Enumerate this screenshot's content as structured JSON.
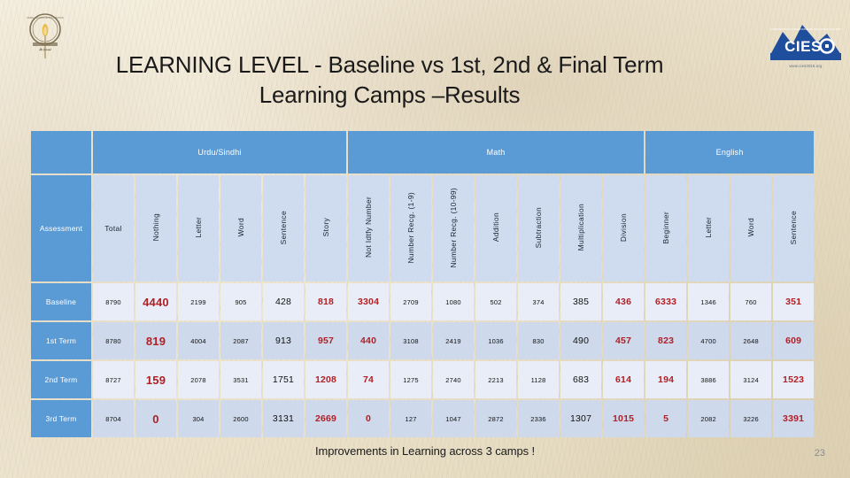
{
  "slide": {
    "title_line1": "LEARNING LEVEL  - Baseline vs 1st, 2nd & Final Term",
    "title_line2": "Learning Camps –Results",
    "footer_note": "Improvements in Learning across 3 camps !",
    "page_number": "23"
  },
  "logos": {
    "left": {
      "name": "institution-seal-logo"
    },
    "right": {
      "name": "cieso-logo",
      "text": "CIESO",
      "url": "www.cies2015.org"
    }
  },
  "colors": {
    "header_blue": "#5b9bd5",
    "subheader_blue": "#cfdcef",
    "row_light": "#e8edf7",
    "row_dark": "#ced9ec",
    "highlight_red": "#b02025",
    "text_dark": "#111111"
  },
  "table": {
    "row_label_header": "Assessment",
    "groups": [
      {
        "label": "",
        "span": 1
      },
      {
        "label": "Urdu/Sindhi",
        "span": 6
      },
      {
        "label": "Math",
        "span": 7
      },
      {
        "label": "English",
        "span": 4
      }
    ],
    "columns": [
      {
        "label": "Total",
        "orientation": "horizontal"
      },
      {
        "label": "Nothing",
        "orientation": "vertical"
      },
      {
        "label": "Letter",
        "orientation": "vertical"
      },
      {
        "label": "Word",
        "orientation": "vertical"
      },
      {
        "label": "Sentence",
        "orientation": "vertical"
      },
      {
        "label": "Story",
        "orientation": "vertical"
      },
      {
        "label": "Not Idtfy Number",
        "orientation": "vertical"
      },
      {
        "label": "Number Recg. (1-9)",
        "orientation": "vertical"
      },
      {
        "label": "Number Recg. (10-99)",
        "orientation": "vertical"
      },
      {
        "label": "Addition",
        "orientation": "vertical"
      },
      {
        "label": "Subtraction",
        "orientation": "vertical"
      },
      {
        "label": "Multiplication",
        "orientation": "vertical"
      },
      {
        "label": "Division",
        "orientation": "vertical"
      },
      {
        "label": "Beginner",
        "orientation": "vertical"
      },
      {
        "label": "Letter",
        "orientation": "vertical"
      },
      {
        "label": "Word",
        "orientation": "vertical"
      },
      {
        "label": "Sentence",
        "orientation": "vertical"
      }
    ],
    "rows": [
      {
        "label": "Baseline",
        "shade": "light",
        "cells": [
          {
            "value": "8790",
            "size": "sm",
            "color": "dark"
          },
          {
            "value": "4440",
            "size": "lg",
            "color": "red"
          },
          {
            "value": "2199",
            "size": "sm",
            "color": "dark"
          },
          {
            "value": "905",
            "size": "sm",
            "color": "dark"
          },
          {
            "value": "428",
            "size": "md",
            "color": "dark"
          },
          {
            "value": "818",
            "size": "md",
            "color": "red"
          },
          {
            "value": "3304",
            "size": "md",
            "color": "red"
          },
          {
            "value": "2709",
            "size": "sm",
            "color": "dark"
          },
          {
            "value": "1080",
            "size": "sm",
            "color": "dark"
          },
          {
            "value": "502",
            "size": "sm",
            "color": "dark"
          },
          {
            "value": "374",
            "size": "sm",
            "color": "dark"
          },
          {
            "value": "385",
            "size": "md",
            "color": "dark"
          },
          {
            "value": "436",
            "size": "md",
            "color": "red"
          },
          {
            "value": "6333",
            "size": "md",
            "color": "red"
          },
          {
            "value": "1346",
            "size": "sm",
            "color": "dark"
          },
          {
            "value": "760",
            "size": "sm",
            "color": "dark"
          },
          {
            "value": "351",
            "size": "md",
            "color": "red"
          }
        ]
      },
      {
        "label": "1st Term",
        "shade": "dark",
        "cells": [
          {
            "value": "8780",
            "size": "sm",
            "color": "dark"
          },
          {
            "value": "819",
            "size": "lg",
            "color": "red"
          },
          {
            "value": "4004",
            "size": "sm",
            "color": "dark"
          },
          {
            "value": "2087",
            "size": "sm",
            "color": "dark"
          },
          {
            "value": "913",
            "size": "md",
            "color": "dark"
          },
          {
            "value": "957",
            "size": "md",
            "color": "red"
          },
          {
            "value": "440",
            "size": "md",
            "color": "red"
          },
          {
            "value": "3108",
            "size": "sm",
            "color": "dark"
          },
          {
            "value": "2419",
            "size": "sm",
            "color": "dark"
          },
          {
            "value": "1036",
            "size": "sm",
            "color": "dark"
          },
          {
            "value": "830",
            "size": "sm",
            "color": "dark"
          },
          {
            "value": "490",
            "size": "md",
            "color": "dark"
          },
          {
            "value": "457",
            "size": "md",
            "color": "red"
          },
          {
            "value": "823",
            "size": "md",
            "color": "red"
          },
          {
            "value": "4700",
            "size": "sm",
            "color": "dark"
          },
          {
            "value": "2648",
            "size": "sm",
            "color": "dark"
          },
          {
            "value": "609",
            "size": "md",
            "color": "red"
          }
        ]
      },
      {
        "label": "2nd Term",
        "shade": "light",
        "cells": [
          {
            "value": "8727",
            "size": "sm",
            "color": "dark"
          },
          {
            "value": "159",
            "size": "lg",
            "color": "red"
          },
          {
            "value": "2078",
            "size": "sm",
            "color": "dark"
          },
          {
            "value": "3531",
            "size": "sm",
            "color": "dark"
          },
          {
            "value": "1751",
            "size": "md",
            "color": "dark"
          },
          {
            "value": "1208",
            "size": "md",
            "color": "red"
          },
          {
            "value": "74",
            "size": "md",
            "color": "red"
          },
          {
            "value": "1275",
            "size": "sm",
            "color": "dark"
          },
          {
            "value": "2740",
            "size": "sm",
            "color": "dark"
          },
          {
            "value": "2213",
            "size": "sm",
            "color": "dark"
          },
          {
            "value": "1128",
            "size": "sm",
            "color": "dark"
          },
          {
            "value": "683",
            "size": "md",
            "color": "dark"
          },
          {
            "value": "614",
            "size": "md",
            "color": "red"
          },
          {
            "value": "194",
            "size": "md",
            "color": "red"
          },
          {
            "value": "3886",
            "size": "sm",
            "color": "dark"
          },
          {
            "value": "3124",
            "size": "sm",
            "color": "dark"
          },
          {
            "value": "1523",
            "size": "md",
            "color": "red"
          }
        ]
      },
      {
        "label": "3rd Term",
        "shade": "dark",
        "cells": [
          {
            "value": "8704",
            "size": "sm",
            "color": "dark"
          },
          {
            "value": "0",
            "size": "lg",
            "color": "red"
          },
          {
            "value": "304",
            "size": "sm",
            "color": "dark"
          },
          {
            "value": "2600",
            "size": "sm",
            "color": "dark"
          },
          {
            "value": "3131",
            "size": "md",
            "color": "dark"
          },
          {
            "value": "2669",
            "size": "md",
            "color": "red"
          },
          {
            "value": "0",
            "size": "md",
            "color": "red"
          },
          {
            "value": "127",
            "size": "sm",
            "color": "dark"
          },
          {
            "value": "1047",
            "size": "sm",
            "color": "dark"
          },
          {
            "value": "2872",
            "size": "sm",
            "color": "dark"
          },
          {
            "value": "2336",
            "size": "sm",
            "color": "dark"
          },
          {
            "value": "1307",
            "size": "md",
            "color": "dark"
          },
          {
            "value": "1015",
            "size": "md",
            "color": "red"
          },
          {
            "value": "5",
            "size": "md",
            "color": "red"
          },
          {
            "value": "2082",
            "size": "sm",
            "color": "dark"
          },
          {
            "value": "3226",
            "size": "sm",
            "color": "dark"
          },
          {
            "value": "3391",
            "size": "md",
            "color": "red"
          }
        ]
      }
    ]
  }
}
